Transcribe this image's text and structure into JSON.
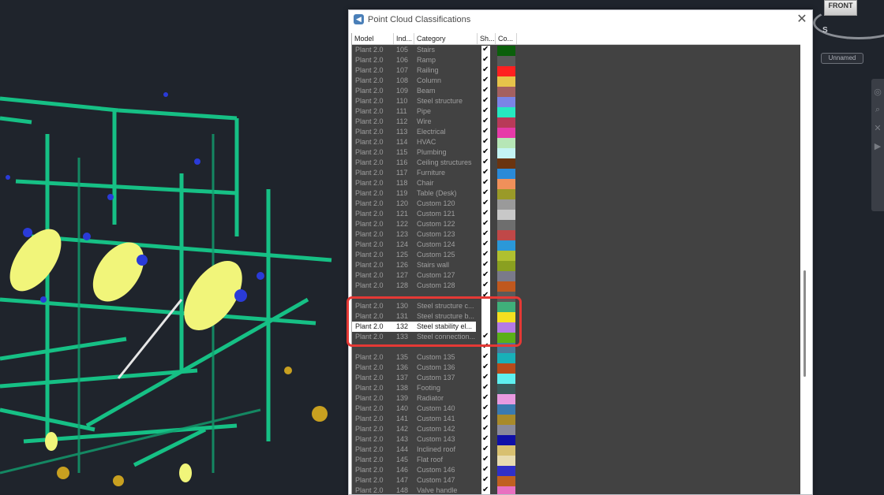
{
  "viewport": {
    "viewcube_label": "FRONT",
    "compass_label": "S",
    "named_view": "Unnamed"
  },
  "dialog": {
    "title": "Point Cloud Classifications",
    "close_symbol": "✕",
    "columns": [
      "Model",
      "Ind...",
      "Category",
      "Sh...",
      "Co..."
    ],
    "rows": [
      {
        "model": "Plant 2.0",
        "index": "105",
        "category": "Stairs",
        "show": true,
        "color": "#0b5f0b"
      },
      {
        "model": "Plant 2.0",
        "index": "106",
        "category": "Ramp",
        "show": true,
        "color": "#5a5a5a"
      },
      {
        "model": "Plant 2.0",
        "index": "107",
        "category": "Railing",
        "show": true,
        "color": "#ff2020"
      },
      {
        "model": "Plant 2.0",
        "index": "108",
        "category": "Column",
        "show": true,
        "color": "#e6c34a"
      },
      {
        "model": "Plant 2.0",
        "index": "109",
        "category": "Beam",
        "show": true,
        "color": "#a46060"
      },
      {
        "model": "Plant 2.0",
        "index": "110",
        "category": "Steel structure",
        "show": true,
        "color": "#7b84e6"
      },
      {
        "model": "Plant 2.0",
        "index": "111",
        "category": "Pipe",
        "show": true,
        "color": "#25e8c0"
      },
      {
        "model": "Plant 2.0",
        "index": "112",
        "category": "Wire",
        "show": true,
        "color": "#b83a58"
      },
      {
        "model": "Plant 2.0",
        "index": "113",
        "category": "Electrical",
        "show": true,
        "color": "#e63aa8"
      },
      {
        "model": "Plant 2.0",
        "index": "114",
        "category": "HVAC",
        "show": true,
        "color": "#b6e6b6"
      },
      {
        "model": "Plant 2.0",
        "index": "115",
        "category": "Plumbing",
        "show": true,
        "color": "#c4f4f4"
      },
      {
        "model": "Plant 2.0",
        "index": "116",
        "category": "Ceiling structures",
        "show": true,
        "color": "#6a3410"
      },
      {
        "model": "Plant 2.0",
        "index": "117",
        "category": "Furniture",
        "show": true,
        "color": "#2a8ad8"
      },
      {
        "model": "Plant 2.0",
        "index": "118",
        "category": "Chair",
        "show": true,
        "color": "#f0905a"
      },
      {
        "model": "Plant 2.0",
        "index": "119",
        "category": "Table (Desk)",
        "show": true,
        "color": "#9a9a28"
      },
      {
        "model": "Plant 2.0",
        "index": "120",
        "category": "Custom 120",
        "show": true,
        "color": "#9a9a9a"
      },
      {
        "model": "Plant 2.0",
        "index": "121",
        "category": "Custom 121",
        "show": true,
        "color": "#c8c8c8"
      },
      {
        "model": "Plant 2.0",
        "index": "122",
        "category": "Custom 122",
        "show": true,
        "color": "#6e6e6e"
      },
      {
        "model": "Plant 2.0",
        "index": "123",
        "category": "Custom 123",
        "show": true,
        "color": "#c04848"
      },
      {
        "model": "Plant 2.0",
        "index": "124",
        "category": "Custom 124",
        "show": true,
        "color": "#2b98d8"
      },
      {
        "model": "Plant 2.0",
        "index": "125",
        "category": "Custom 125",
        "show": true,
        "color": "#b0c030"
      },
      {
        "model": "Plant 2.0",
        "index": "126",
        "category": "Stairs wall",
        "show": true,
        "color": "#8aa020"
      },
      {
        "model": "Plant 2.0",
        "index": "127",
        "category": "Custom 127",
        "show": true,
        "color": "#7a7a8a"
      },
      {
        "model": "Plant 2.0",
        "index": "128",
        "category": "Custom 128",
        "show": true,
        "color": "#c0581e"
      },
      {
        "model": "",
        "index": "",
        "category": "",
        "show": true,
        "color": "#5a5a5a"
      },
      {
        "model": "Plant 2.0",
        "index": "130",
        "category": "Steel structure c...",
        "show": false,
        "color": "#3fb07a"
      },
      {
        "model": "Plant 2.0",
        "index": "131",
        "category": "Steel structure b...",
        "show": false,
        "color": "#f4e020"
      },
      {
        "model": "Plant 2.0",
        "index": "132",
        "category": "Steel stability el...",
        "show": false,
        "color": "#b47ae6",
        "selected": true
      },
      {
        "model": "Plant 2.0",
        "index": "133",
        "category": "Steel connection...",
        "show": true,
        "color": "#5ab018"
      },
      {
        "model": "",
        "index": "",
        "category": "",
        "show": true,
        "color": "#4a7a9a"
      },
      {
        "model": "Plant 2.0",
        "index": "135",
        "category": "Custom 135",
        "show": true,
        "color": "#18b0b8"
      },
      {
        "model": "Plant 2.0",
        "index": "136",
        "category": "Custom 136",
        "show": true,
        "color": "#b84a1a"
      },
      {
        "model": "Plant 2.0",
        "index": "137",
        "category": "Custom 137",
        "show": true,
        "color": "#5ef0f0"
      },
      {
        "model": "Plant 2.0",
        "index": "138",
        "category": "Footing",
        "show": true,
        "color": "#3a5a5a"
      },
      {
        "model": "Plant 2.0",
        "index": "139",
        "category": "Radiator",
        "show": true,
        "color": "#e89ae0"
      },
      {
        "model": "Plant 2.0",
        "index": "140",
        "category": "Custom 140",
        "show": true,
        "color": "#3a7ab0"
      },
      {
        "model": "Plant 2.0",
        "index": "141",
        "category": "Custom 141",
        "show": true,
        "color": "#a88a2a"
      },
      {
        "model": "Plant 2.0",
        "index": "142",
        "category": "Custom 142",
        "show": true,
        "color": "#8a8a9a"
      },
      {
        "model": "Plant 2.0",
        "index": "143",
        "category": "Custom 143",
        "show": true,
        "color": "#1010a8"
      },
      {
        "model": "Plant 2.0",
        "index": "144",
        "category": "Inclined roof",
        "show": true,
        "color": "#d8c070"
      },
      {
        "model": "Plant 2.0",
        "index": "145",
        "category": "Flat roof",
        "show": true,
        "color": "#e8dcb0"
      },
      {
        "model": "Plant 2.0",
        "index": "146",
        "category": "Custom 146",
        "show": true,
        "color": "#3030c8"
      },
      {
        "model": "Plant 2.0",
        "index": "147",
        "category": "Custom 147",
        "show": true,
        "color": "#c06020"
      },
      {
        "model": "Plant 2.0",
        "index": "148",
        "category": "Valve handle",
        "show": true,
        "color": "#e870c0"
      }
    ]
  }
}
